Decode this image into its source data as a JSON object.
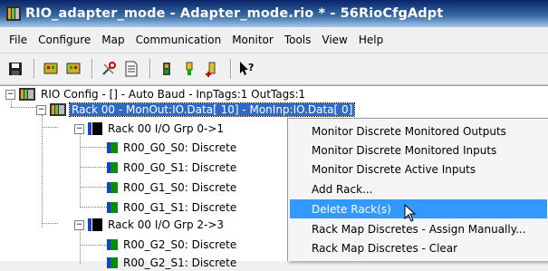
{
  "window": {
    "title": "RIO_adapter_mode - Adapter_mode.rio * - 56RioCfgAdpt"
  },
  "menu": [
    "File",
    "Configure",
    "Map",
    "Communication",
    "Monitor",
    "Tools",
    "View",
    "Help"
  ],
  "toolbar": {
    "buttons": [
      {
        "name": "save-icon"
      },
      {
        "name": "monitor-red-icon"
      },
      {
        "name": "monitor-green-icon"
      },
      {
        "name": "tools-icon"
      },
      {
        "name": "document-icon"
      },
      {
        "name": "adapter-icon"
      },
      {
        "name": "adapter-yellow-icon"
      },
      {
        "name": "adapter-plus-icon"
      },
      {
        "name": "help-pointer-icon"
      }
    ]
  },
  "tree": {
    "root": "RIO Config - [] - Auto Baud - InpTags:1 OutTags:1",
    "rack": "Rack 00 - MonOut:IO.Data[ 10] - MonInp:IO.Data[ 0]",
    "group1": "Rack 00 I/O Grp 0->1",
    "items1": [
      "R00_G0_S0: Discrete",
      "R00_G0_S1: Discrete",
      "R00_G1_S0: Discrete",
      "R00_G1_S1: Discrete"
    ],
    "group2": "Rack 00 I/O Grp 2->3",
    "items2": [
      "R00_G2_S0: Discrete",
      "R00_G2_S1: Discrete"
    ]
  },
  "context_menu": {
    "items": [
      "Monitor Discrete Monitored Outputs",
      "Monitor Discrete Monitored Inputs",
      "Monitor Discrete Active Inputs",
      "Add Rack...",
      "Delete Rack(s)",
      "Rack Map Discretes - Assign Manually...",
      "Rack Map Discretes - Clear"
    ],
    "highlighted_index": 4
  },
  "colors": {
    "selection": "#316ac5",
    "menu_highlight": "#3399ff",
    "titlebar": "#0a246a"
  }
}
